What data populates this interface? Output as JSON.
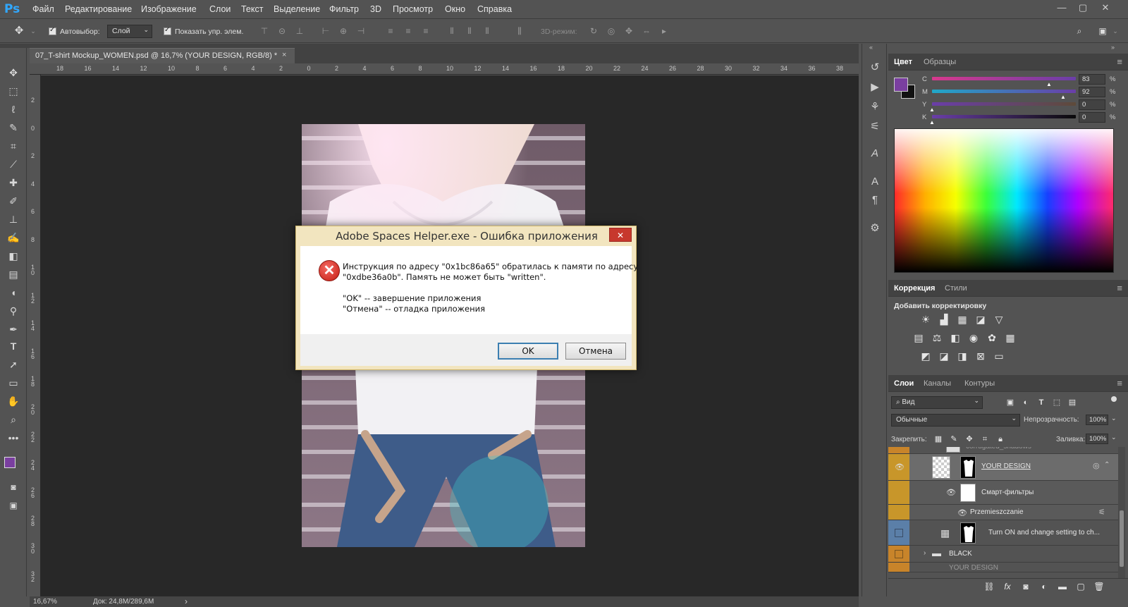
{
  "app": {
    "logo": "Ps",
    "window_controls": [
      "—",
      "▢",
      "✕"
    ]
  },
  "menu": [
    "Файл",
    "Редактирование",
    "Изображение",
    "Слои",
    "Текст",
    "Выделение",
    "Фильтр",
    "3D",
    "Просмотр",
    "Окно",
    "Справка"
  ],
  "options": {
    "autoselect_label": "Автовыбор:",
    "autoselect_value": "Слой",
    "show_controls_label": "Показать упр. элем.",
    "mode3d_label": "3D-режим:"
  },
  "document": {
    "tab_title": "07_T-shirt Mockup_WOMEN.psd @ 16,7% (YOUR DESIGN, RGB/8) *",
    "tab_close": "×"
  },
  "ruler": {
    "top_ticks": [
      "18",
      "16",
      "14",
      "12",
      "10",
      "8",
      "6",
      "4",
      "2",
      "0",
      "2",
      "4",
      "6",
      "8",
      "10",
      "12",
      "14",
      "16",
      "18",
      "20",
      "22",
      "24",
      "26",
      "28",
      "30",
      "32",
      "34",
      "36",
      "38"
    ],
    "left_ticks": [
      "2",
      "0",
      "2",
      "4",
      "6",
      "8",
      "1\n0",
      "1\n2",
      "1\n4",
      "1\n6",
      "1\n8",
      "2\n0",
      "2\n2",
      "2\n4",
      "2\n6",
      "2\n8",
      "3\n0",
      "3\n2"
    ]
  },
  "status": {
    "zoom": "16,67%",
    "doc_size": "Док: 24,8M/289,6M",
    "arrow": "›"
  },
  "color_panel": {
    "tabs": [
      "Цвет",
      "Образцы"
    ],
    "foreground": "#7a3fa0",
    "background": "#111111",
    "channels": [
      {
        "label": "C",
        "value": "83",
        "unit": "%"
      },
      {
        "label": "M",
        "value": "92",
        "unit": "%"
      },
      {
        "label": "Y",
        "value": "0",
        "unit": "%"
      },
      {
        "label": "K",
        "value": "0",
        "unit": "%"
      }
    ]
  },
  "adjust_panel": {
    "tabs": [
      "Коррекция",
      "Стили"
    ],
    "add_label": "Добавить корректировку"
  },
  "layers_panel": {
    "tabs": [
      "Слои",
      "Каналы",
      "Контуры"
    ],
    "filter_kind": "Вид",
    "blend_mode": "Обычные",
    "opacity_label": "Непрозрачность:",
    "opacity_value": "100%",
    "lock_label": "Закрепить:",
    "fill_label": "Заливка:",
    "fill_value": "100%",
    "layers": {
      "partial_top": "corrugated_shadows",
      "your_design": "YOUR DESIGN",
      "smart_filters": "Смарт-фильтры",
      "filter_item": "Przemieszczanie",
      "turn_on": "Turn ON and change setting to ch...",
      "black": "BLACK",
      "partial_bottom": "YOUR DESIGN"
    }
  },
  "dialog": {
    "title": "Adobe Spaces Helper.exe - Ошибка приложения",
    "line1": "Инструкция по адресу \"0x1bc86a65\" обратилась к памяти по адресу",
    "line2": "\"0xdbe36a0b\". Память не может быть \"written\".",
    "line3": "\"OK\" -- завершение приложения",
    "line4": "\"Отмена\" -- отладка приложения",
    "ok": "OK",
    "cancel": "Отмена",
    "close": "✕"
  }
}
